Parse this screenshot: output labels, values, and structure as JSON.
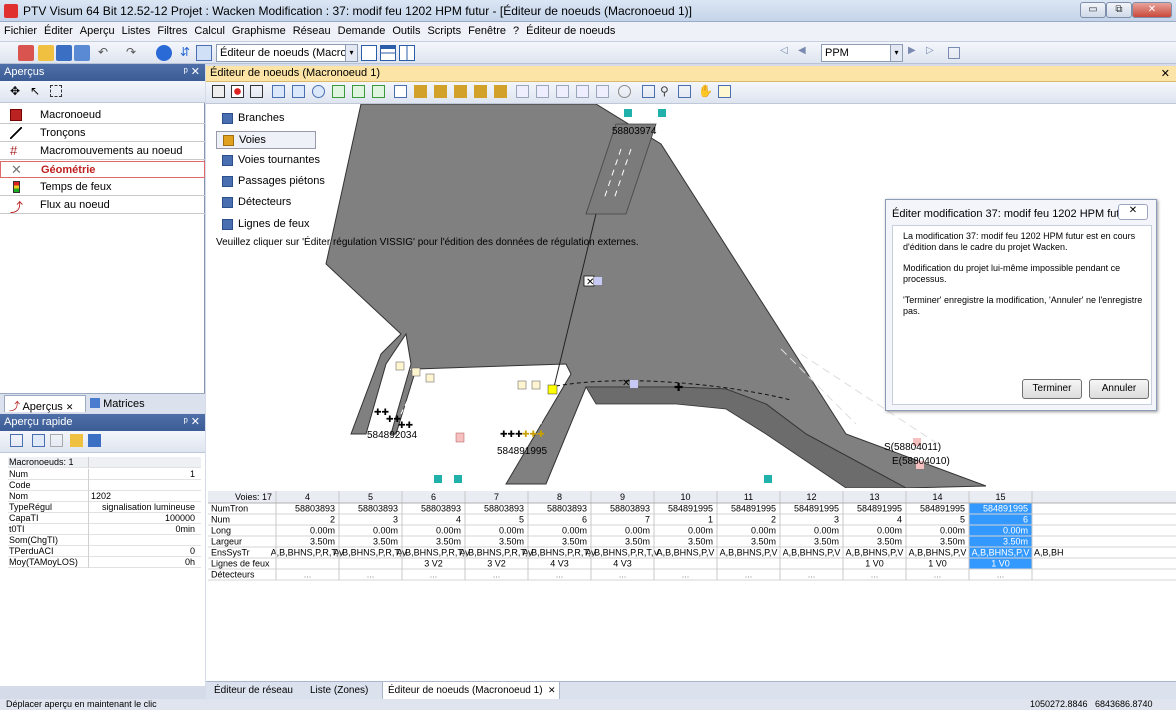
{
  "window": {
    "title": "PTV Visum 64 Bit 12.52-12 Projet : Wacken Modification : 37: modif feu 1202 HPM futur  - [Éditeur de noeuds (Macronoeud 1)]",
    "minimize": "▭",
    "restore": "⧉",
    "close": "✕"
  },
  "menu": [
    "Fichier",
    "Éditer",
    "Aperçu",
    "Listes",
    "Filtres",
    "Calcul",
    "Graphisme",
    "Réseau",
    "Demande",
    "Outils",
    "Scripts",
    "Fenêtre",
    "?",
    "Éditeur de noeuds"
  ],
  "toolbar": {
    "editor_combo": "Éditeur de noeuds (Macro",
    "ppm_combo": "PPM"
  },
  "overviews": {
    "title": "Aperçus",
    "pin": "ᵖ ✕",
    "items": [
      {
        "label": "Macronoeud",
        "icon": "macronode-icon"
      },
      {
        "label": "Tronçons",
        "icon": "link-icon"
      },
      {
        "label": "Macromouvements au noeud",
        "icon": "turns-icon"
      },
      {
        "label": "Géométrie",
        "icon": "geometry-icon"
      },
      {
        "label": "Temps de feux",
        "icon": "signal-icon"
      },
      {
        "label": "Flux au noeud",
        "icon": "flow-icon"
      }
    ],
    "tab_apercus": "Aperçus",
    "tab_matrices": "Matrices"
  },
  "quick_view": {
    "title": "Aperçu rapide",
    "pin": "ᵖ ✕",
    "header_key": "Macronoeuds: 1",
    "rows": [
      {
        "k": "Num",
        "v": "1"
      },
      {
        "k": "Code",
        "v": ""
      },
      {
        "k": "Nom",
        "v": "1202"
      },
      {
        "k": "TypeRégul",
        "v": "signalisation lumineuse"
      },
      {
        "k": "CapaTI",
        "v": "100000"
      },
      {
        "k": "t0TI",
        "v": "0min"
      },
      {
        "k": "Som(ChgTI)",
        "v": ""
      },
      {
        "k": "TPerduACI",
        "v": "0"
      },
      {
        "k": "Moy(TAMoyLOS)",
        "v": "0h"
      }
    ]
  },
  "editor": {
    "tab_title": "Éditeur de noeuds (Macronoeud 1)",
    "close": "✕",
    "layers": [
      "Branches",
      "Voies",
      "Voies tournantes",
      "Passages piétons",
      "Détecteurs",
      "Lignes de feux"
    ],
    "hint": "Veuillez cliquer sur 'Éditer régulation VISSIG' pour l'édition des données de régulation externes.",
    "node_labels": [
      "58803974",
      "584892034",
      "584891995",
      "S(58804011)",
      "E(58804010)"
    ]
  },
  "dialog": {
    "title": "Éditer modification 37: modif feu 1202 HPM futur",
    "close": "✕",
    "para1": "La modification 37: modif feu 1202 HPM futur est en cours d'édition dans le cadre du projet Wacken.",
    "para2": "Modification du projet lui-même impossible pendant ce processus.",
    "para3": "'Terminer' enregistre la modification, 'Annuler' ne l'enregistre pas.",
    "ok": "Terminer",
    "cancel": "Annuler"
  },
  "grid": {
    "corner": "Voies: 17",
    "columns": [
      "4",
      "5",
      "6",
      "7",
      "8",
      "9",
      "10",
      "11",
      "12",
      "13",
      "14",
      "15"
    ],
    "rows": [
      {
        "label": "NumTron",
        "cells": [
          "58803893",
          "58803893",
          "58803893",
          "58803893",
          "58803893",
          "58803893",
          "584891995",
          "584891995",
          "584891995",
          "584891995",
          "584891995",
          "584891995"
        ]
      },
      {
        "label": "Num",
        "cells": [
          "2",
          "3",
          "4",
          "5",
          "6",
          "7",
          "1",
          "2",
          "3",
          "4",
          "5",
          "6"
        ]
      },
      {
        "label": "Long",
        "cells": [
          "0.00m",
          "0.00m",
          "0.00m",
          "0.00m",
          "0.00m",
          "0.00m",
          "0.00m",
          "0.00m",
          "0.00m",
          "0.00m",
          "0.00m",
          "0.00m"
        ]
      },
      {
        "label": "Largeur",
        "cells": [
          "3.50m",
          "3.50m",
          "3.50m",
          "3.50m",
          "3.50m",
          "3.50m",
          "3.50m",
          "3.50m",
          "3.50m",
          "3.50m",
          "3.50m",
          "3.50m"
        ]
      },
      {
        "label": "EnsSysTr",
        "cells": [
          "A,B,BHNS,P,R,T,V",
          "A,B,BHNS,P,R,T,V",
          "A,B,BHNS,P,R,T,V",
          "A,B,BHNS,P,R,T,V",
          "A,B,BHNS,P,R,T,V",
          "A,B,BHNS,P,R,T,V",
          "A,B,BHNS,P,V",
          "A,B,BHNS,P,V",
          "A,B,BHNS,P,V",
          "A,B,BHNS,P,V",
          "A,B,BHNS,P,V",
          "A,B,BHNS,P,V"
        ]
      },
      {
        "label": "Lignes de feux",
        "cells": [
          "",
          "",
          "3 V2",
          "3 V2",
          "4 V3",
          "4 V3",
          "",
          "",
          "",
          "1 V0",
          "1 V0",
          "1 V0"
        ]
      },
      {
        "label": "Détecteurs",
        "cells": [
          "...",
          "...",
          "...",
          "...",
          "...",
          "...",
          "...",
          "...",
          "...",
          "...",
          "...",
          "..."
        ]
      }
    ],
    "overflow_text": "A,B,BH"
  },
  "bottom_tabs": [
    "Éditeur de réseau",
    "Liste (Zones)",
    "Éditeur de noeuds (Macronoeud 1)"
  ],
  "bottom_tab_close": "✕",
  "status": {
    "text": "Déplacer aperçu en maintenant le clic",
    "x": "1050272.8846",
    "y": "6843686.8740"
  },
  "colors": {
    "accent": "#3c5e97",
    "selected_cell": "#3399ff",
    "editor_tab": "#fbe4a6"
  }
}
